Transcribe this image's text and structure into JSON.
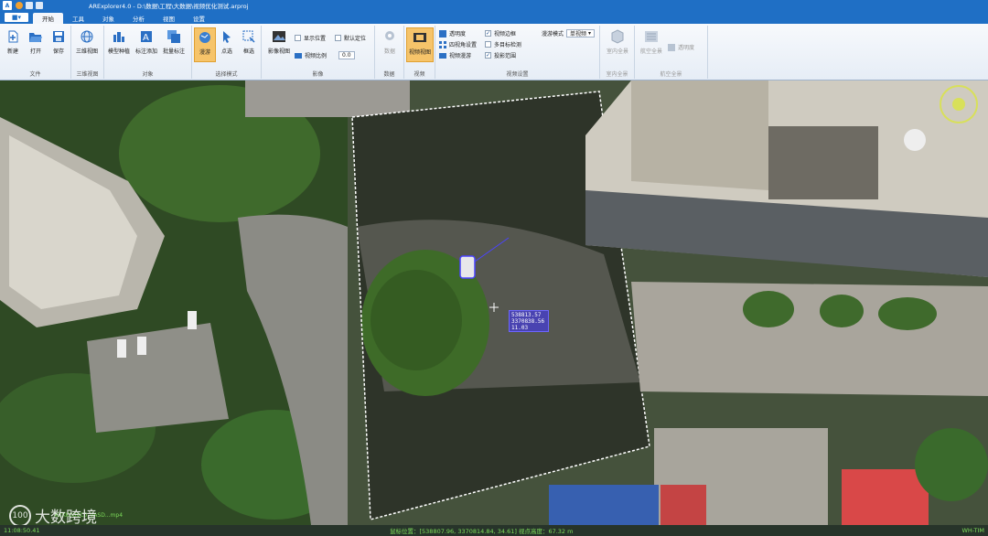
{
  "app": {
    "title": "ARExplorer4.0 - D:\\数据\\工程\\大数据\\视频优化测试.arproj",
    "logo": "A"
  },
  "menu": {
    "app_button": "■▾",
    "tabs": [
      {
        "label": "开始",
        "active": true
      },
      {
        "label": "工具"
      },
      {
        "label": "对象"
      },
      {
        "label": "分析"
      },
      {
        "label": "视图"
      },
      {
        "label": "设置"
      }
    ]
  },
  "ribbon": {
    "file": {
      "label": "文件",
      "new": "新建",
      "open": "打开",
      "save": "保存"
    },
    "view3d": {
      "label": "三维视图",
      "button": "三维视图"
    },
    "object": {
      "label": "对象",
      "model": "模型种植",
      "annotate": "标注添加",
      "batch": "批量标注"
    },
    "select": {
      "label": "选择模式",
      "roam": "漫游",
      "point": "点选",
      "box": "框选"
    },
    "image": {
      "label": "影像",
      "view": "影像视图",
      "show_position": "显示位置",
      "default_position": "默认定位",
      "ratio": "视频比例",
      "ratio_value": "0.0"
    },
    "data": {
      "label": "数据",
      "button": "数据"
    },
    "video": {
      "label": "视频",
      "button": "视频视图"
    },
    "video_settings": {
      "label": "视频设置",
      "transparency": "透明度",
      "four_corner": "四视角设置",
      "roaming": "视频漫游",
      "border": "视频边框",
      "multi_target": "多目标检测",
      "projection": "投影范围",
      "mode_label": "漫游模式",
      "mode_value": "单视频"
    },
    "indoor": {
      "label": "室内全景",
      "button": "室内全景"
    },
    "aerial": {
      "label": "航空全景",
      "button": "航空全景",
      "transparent": "透明度"
    }
  },
  "map": {
    "coord_tag": [
      "538813.57",
      "3370838.56",
      "11.03"
    ],
    "file_label": "KKKK00VC0_0ASD...mp4"
  },
  "status": {
    "left": "11:08:50.41",
    "center": "鼠标位置：[538807.96, 3370814.84, 34.61]  视点高度：67.32 m",
    "right": "WH-TIM"
  },
  "watermark": {
    "mark": "100",
    "text": "大数跨境"
  }
}
